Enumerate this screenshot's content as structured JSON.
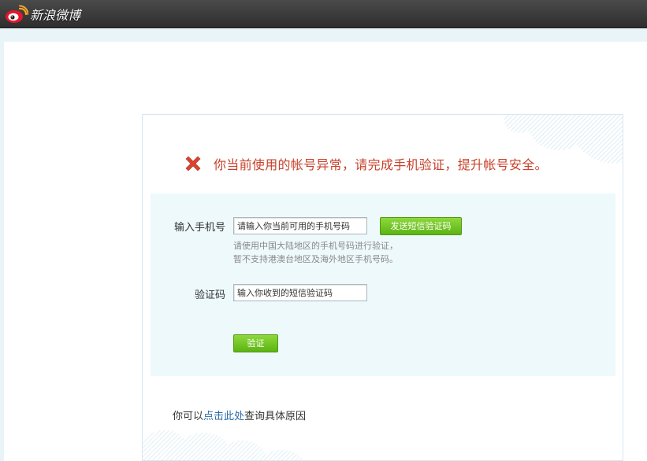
{
  "header": {
    "brand_name": "新浪微博",
    "logo_icon": "weibo-eye-logo-icon"
  },
  "alert": {
    "icon": "error-x-icon",
    "message": "你当前使用的帐号异常，请完成手机验证，提升帐号安全。",
    "color": "#c8412b"
  },
  "form": {
    "phone_label": "输入手机号",
    "phone_placeholder": "请输入你当前可用的手机号码",
    "send_code_button": "发送短信验证码",
    "hint_line1": "请使用中国大陆地区的手机号码进行验证，",
    "hint_line2": "暂不支持港澳台地区及海外地区手机号码。",
    "code_label": "验证码",
    "code_placeholder": "输入你收到的短信验证码",
    "verify_button": "验证"
  },
  "footer": {
    "prefix": "你可以",
    "link_text": "点击此处",
    "suffix": "查询具体原因"
  },
  "colors": {
    "accent_green": "#6cc21f",
    "link_blue": "#2b6ba8",
    "panel_bg": "#eef9fc"
  }
}
